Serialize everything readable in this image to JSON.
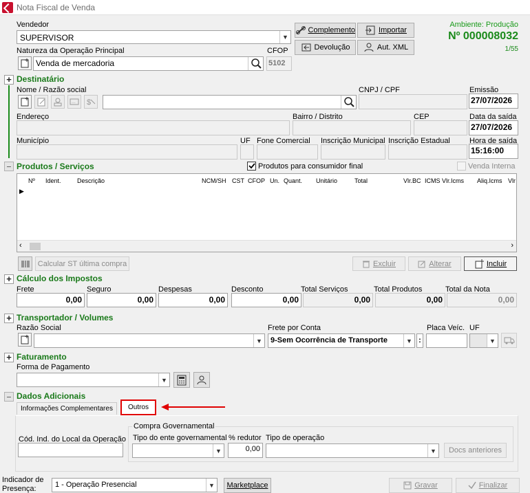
{
  "window": {
    "title": "Nota Fiscal de Venda"
  },
  "header": {
    "vendedor_label": "Vendedor",
    "vendedor_value": "SUPERVISOR",
    "natureza_label": "Natureza da Operação Principal",
    "natureza_value": "Venda de mercadoria",
    "cfop_label": "CFOP",
    "cfop_value": "5102",
    "btn_complemento": "Complemento",
    "btn_importar": "Importar",
    "btn_devolucao": "Devolução",
    "btn_aut_xml": "Aut. XML",
    "ambiente": "Ambiente: Produção",
    "numero": "Nº 000008032",
    "pagina": "1/55"
  },
  "destinatario": {
    "title": "Destinatário",
    "nome_label": "Nome / Razão social",
    "cnpj_label": "CNPJ / CPF",
    "emissao_label": "Emissão",
    "emissao_value": "27/07/2026",
    "endereco_label": "Endereço",
    "bairro_label": "Bairro / Distrito",
    "cep_label": "CEP",
    "data_saida_label": "Data da saída",
    "data_saida_value": "27/07/2026",
    "municipio_label": "Município",
    "uf_label": "UF",
    "fone_label": "Fone Comercial",
    "im_label": "Inscrição Municipal",
    "ie_label": "Inscrição Estadual",
    "hora_saida_label": "Hora de saída",
    "hora_saida_value": "15:16:00"
  },
  "produtos": {
    "title": "Produtos / Serviços",
    "consumidor_final": "Produtos para consumidor final",
    "venda_interna": "Venda Interna",
    "columns": [
      "Nº",
      "Ident.",
      "Descrição",
      "NCM/SH",
      "CST",
      "CFOP",
      "Un.",
      "Quant.",
      "Unitário",
      "Total",
      "Vlr.BC",
      "ICMS",
      "Vlr.Icms",
      "Aliq.Icms",
      "Vlr"
    ],
    "btn_calcular": "Calcular ST última compra",
    "btn_excluir": "Excluir",
    "btn_alterar": "Alterar",
    "btn_incluir": "Incluir"
  },
  "impostos": {
    "title": "Cálculo dos Impostos",
    "fields": [
      {
        "label": "Frete",
        "value": "0,00"
      },
      {
        "label": "Seguro",
        "value": "0,00"
      },
      {
        "label": "Despesas",
        "value": "0,00"
      },
      {
        "label": "Desconto",
        "value": "0,00"
      },
      {
        "label": "Total Serviços",
        "value": "0,00"
      },
      {
        "label": "Total Produtos",
        "value": "0,00"
      },
      {
        "label": "Total da Nota",
        "value": "0,00"
      }
    ]
  },
  "transportador": {
    "title": "Transportador / Volumes",
    "razao_label": "Razão Social",
    "frete_label": "Frete por Conta",
    "frete_value": "9-Sem Ocorrência de Transporte",
    "placa_label": "Placa Veíc.",
    "uf_label": "UF"
  },
  "faturamento": {
    "title": "Faturamento",
    "forma_label": "Forma de Pagamento"
  },
  "dados": {
    "title": "Dados Adicionais",
    "tab_info": "Informações Complementares",
    "tab_outros": "Outros",
    "cod_local_label": "Cód. Ind. do Local da Operação",
    "compra_gov_label": "Compra Governamental",
    "tipo_ente_label": "Tipo do ente governamental",
    "redutor_label": "% redutor",
    "redutor_value": "0,00",
    "tipo_op_label": "Tipo de operação",
    "btn_docs": "Docs anteriores"
  },
  "footer": {
    "indicador_label1": "Indicador de",
    "indicador_label2": "Presença:",
    "indicador_value": "1 - Operação Presencial",
    "btn_marketplace": "Marketplace",
    "btn_gravar": "Gravar",
    "btn_finalizar": "Finalizar"
  },
  "colors": {
    "section_green": "#1a7a1a",
    "highlight_red": "#e00000"
  }
}
